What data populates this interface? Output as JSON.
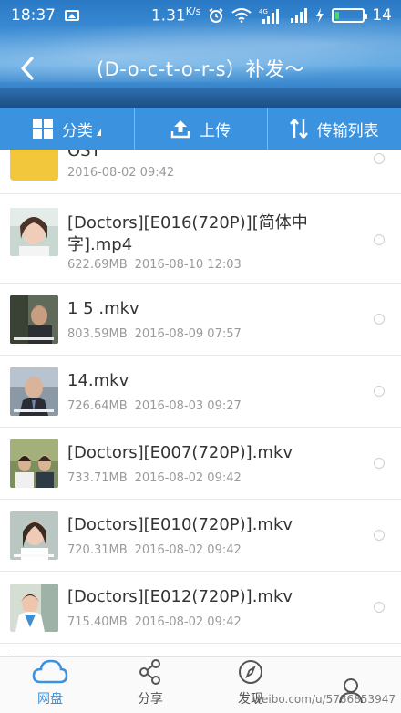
{
  "status_bar": {
    "time": "18:37",
    "speed_value": "1.31",
    "speed_unit": "K/s",
    "network": "4G",
    "battery_level": "14"
  },
  "header": {
    "title": "(D-o-c-t-o-r-s）补发～",
    "back_icon": "chevron-left-icon"
  },
  "toolbar": {
    "category_label": "分类",
    "upload_label": "上传",
    "transfer_label": "传输列表"
  },
  "files": [
    {
      "name": "OST",
      "size": "",
      "date": "2016-08-02  09:42",
      "type": "folder"
    },
    {
      "name": "[Doctors][E016(720P)][简体中字].mp4",
      "size": "622.69MB",
      "date": "2016-08-10  12:03",
      "type": "video"
    },
    {
      "name": "1 5 .mkv",
      "size": "803.59MB",
      "date": "2016-08-09  07:57",
      "type": "video"
    },
    {
      "name": "14.mkv",
      "size": "726.64MB",
      "date": "2016-08-03  09:27",
      "type": "video"
    },
    {
      "name": "[Doctors][E007(720P)].mkv",
      "size": "733.71MB",
      "date": "2016-08-02  09:42",
      "type": "video"
    },
    {
      "name": "[Doctors][E010(720P)].mkv",
      "size": "720.31MB",
      "date": "2016-08-02  09:42",
      "type": "video"
    },
    {
      "name": "[Doctors][E012(720P)].mkv",
      "size": "715.40MB",
      "date": "2016-08-02  09:42",
      "type": "video"
    }
  ],
  "bottom_nav": {
    "items": [
      {
        "label": "网盘",
        "icon": "cloud-icon",
        "active": true
      },
      {
        "label": "分享",
        "icon": "share-icon",
        "active": false
      },
      {
        "label": "发现",
        "icon": "compass-icon",
        "active": false
      },
      {
        "label": "",
        "icon": "user-icon",
        "active": false
      }
    ]
  },
  "watermark": "weibo.com/u/5786853947",
  "colors": {
    "accent": "#3b93e0",
    "folder": "#f2c73b"
  }
}
